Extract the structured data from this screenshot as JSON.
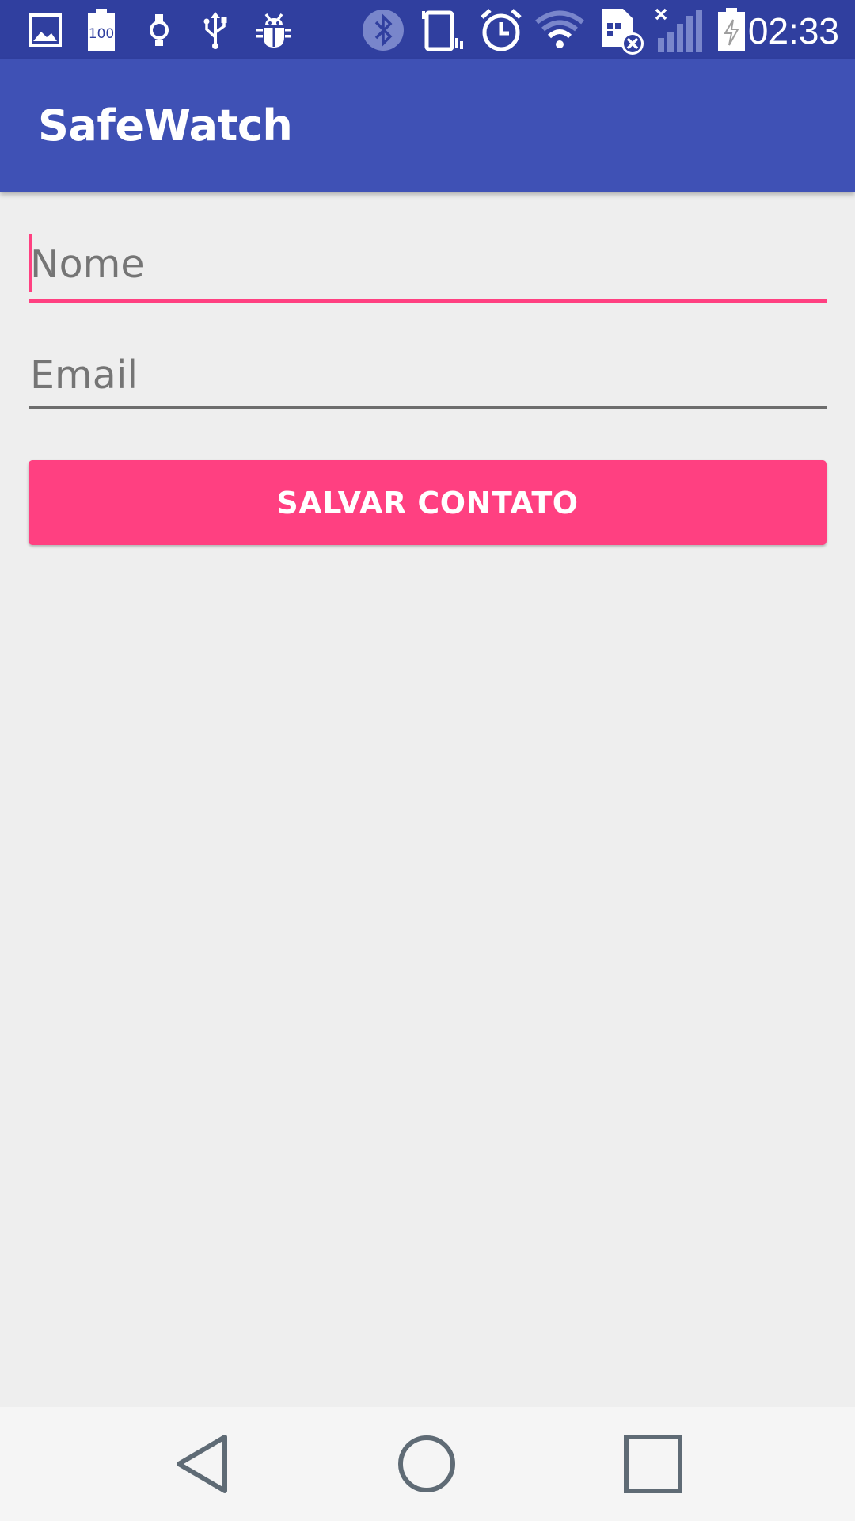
{
  "status_bar": {
    "time": "02:33",
    "icons": [
      "image-icon",
      "battery-100-icon",
      "watch-icon",
      "usb-icon",
      "bug-icon",
      "bluetooth-icon",
      "vibrate-icon",
      "alarm-icon",
      "wifi-icon",
      "sim-error-icon",
      "signal-icon",
      "battery-charging-icon"
    ],
    "battery_badge": "100"
  },
  "app_bar": {
    "title": "SafeWatch"
  },
  "form": {
    "name_placeholder": "Nome",
    "name_value": "",
    "email_placeholder": "Email",
    "email_value": "",
    "save_label": "SALVAR CONTATO"
  },
  "colors": {
    "status_bar": "#303f9f",
    "primary": "#3f51b5",
    "accent": "#ff4081",
    "background": "#eeeeee"
  },
  "nav_bar": {
    "icons": [
      "back-icon",
      "home-icon",
      "recents-icon"
    ]
  }
}
